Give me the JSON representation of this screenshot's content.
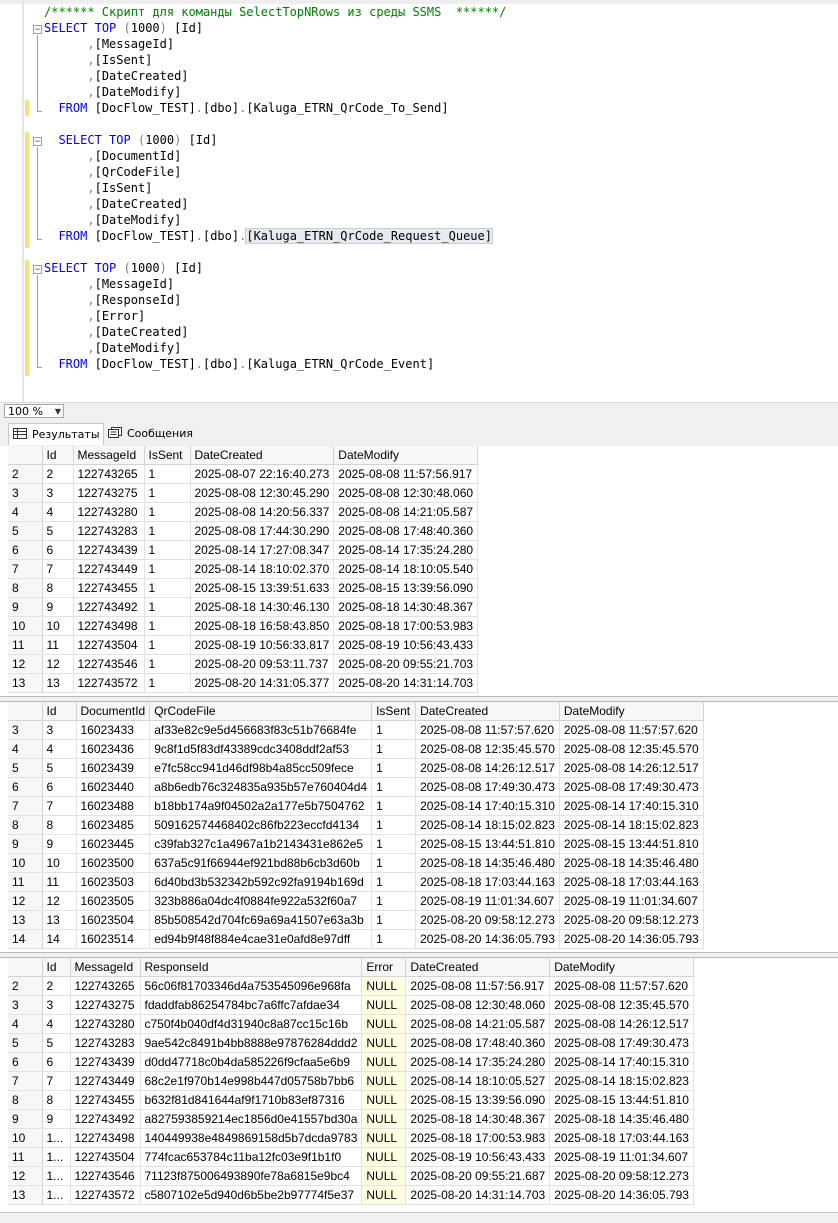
{
  "editor": {
    "comment": "/****** Скрипт для команды SelectTopNRows из среды SSMS  ******/",
    "q1": {
      "select": "SELECT",
      "top": "TOP",
      "n": "(1000)",
      "first": "[Id]",
      "cols": [
        "[MessageId]",
        "[IsSent]",
        "[DateCreated]",
        "[DateModify]"
      ],
      "from": "FROM",
      "db": "[DocFlow_TEST]",
      "schema": "[dbo]",
      "table": "[Kaluga_ETRN_QrCode_To_Send]"
    },
    "q2": {
      "select": "SELECT",
      "top": "TOP",
      "n": "(1000)",
      "first": "[Id]",
      "cols": [
        "[DocumentId]",
        "[QrCodeFile]",
        "[IsSent]",
        "[DateCreated]",
        "[DateModify]"
      ],
      "from": "FROM",
      "db": "[DocFlow_TEST]",
      "schema": "[dbo]",
      "table": "[Kaluga_ETRN_QrCode_Request_Queue]"
    },
    "q3": {
      "select": "SELECT",
      "top": "TOP",
      "n": "(1000)",
      "first": "[Id]",
      "cols": [
        "[MessageId]",
        "[ResponseId]",
        "[Error]",
        "[DateCreated]",
        "[DateModify]"
      ],
      "from": "FROM",
      "db": "[DocFlow_TEST]",
      "schema": "[dbo]",
      "table": "[Kaluga_ETRN_QrCode_Event]"
    }
  },
  "zoom": {
    "value": "100 %"
  },
  "tabs": {
    "results": "Результаты",
    "messages": "Сообщения"
  },
  "grid1": {
    "headers": [
      "",
      "Id",
      "MessageId",
      "IsSent",
      "DateCreated",
      "DateModify"
    ],
    "rows": [
      [
        "2",
        "2",
        "122743265",
        "1",
        "2025-08-07 22:16:40.273",
        "2025-08-08 11:57:56.917"
      ],
      [
        "3",
        "3",
        "122743275",
        "1",
        "2025-08-08 12:30:45.290",
        "2025-08-08 12:30:48.060"
      ],
      [
        "4",
        "4",
        "122743280",
        "1",
        "2025-08-08 14:20:56.337",
        "2025-08-08 14:21:05.587"
      ],
      [
        "5",
        "5",
        "122743283",
        "1",
        "2025-08-08 17:44:30.290",
        "2025-08-08 17:48:40.360"
      ],
      [
        "6",
        "6",
        "122743439",
        "1",
        "2025-08-14 17:27:08.347",
        "2025-08-14 17:35:24.280"
      ],
      [
        "7",
        "7",
        "122743449",
        "1",
        "2025-08-14 18:10:02.370",
        "2025-08-14 18:10:05.540"
      ],
      [
        "8",
        "8",
        "122743455",
        "1",
        "2025-08-15 13:39:51.633",
        "2025-08-15 13:39:56.090"
      ],
      [
        "9",
        "9",
        "122743492",
        "1",
        "2025-08-18 14:30:46.130",
        "2025-08-18 14:30:48.367"
      ],
      [
        "10",
        "10",
        "122743498",
        "1",
        "2025-08-18 16:58:43.850",
        "2025-08-18 17:00:53.983"
      ],
      [
        "11",
        "11",
        "122743504",
        "1",
        "2025-08-19 10:56:33.817",
        "2025-08-19 10:56:43.433"
      ],
      [
        "12",
        "12",
        "122743546",
        "1",
        "2025-08-20 09:53:11.737",
        "2025-08-20 09:55:21.703"
      ],
      [
        "13",
        "13",
        "122743572",
        "1",
        "2025-08-20 14:31:05.377",
        "2025-08-20 14:31:14.703"
      ]
    ]
  },
  "grid2": {
    "headers": [
      "",
      "Id",
      "DocumentId",
      "QrCodeFile",
      "IsSent",
      "DateCreated",
      "DateModify"
    ],
    "rows": [
      [
        "3",
        "3",
        "16023433",
        "af33e82c9e5d456683f83c51b76684fe",
        "1",
        "2025-08-08 11:57:57.620",
        "2025-08-08 11:57:57.620"
      ],
      [
        "4",
        "4",
        "16023436",
        "9c8f1d5f83df43389cdc3408ddf2af53",
        "1",
        "2025-08-08 12:35:45.570",
        "2025-08-08 12:35:45.570"
      ],
      [
        "5",
        "5",
        "16023439",
        "e7fc58cc941d46df98b4a85cc509fece",
        "1",
        "2025-08-08 14:26:12.517",
        "2025-08-08 14:26:12.517"
      ],
      [
        "6",
        "6",
        "16023440",
        "a8b6edb76c324835a935b57e760404d4",
        "1",
        "2025-08-08 17:49:30.473",
        "2025-08-08 17:49:30.473"
      ],
      [
        "7",
        "7",
        "16023488",
        "b18bb174a9f04502a2a177e5b7504762",
        "1",
        "2025-08-14 17:40:15.310",
        "2025-08-14 17:40:15.310"
      ],
      [
        "8",
        "8",
        "16023485",
        "509162574468402c86fb223eccfd4134",
        "1",
        "2025-08-14 18:15:02.823",
        "2025-08-14 18:15:02.823"
      ],
      [
        "9",
        "9",
        "16023445",
        "c39fab327c1a4967a1b2143431e862e5",
        "1",
        "2025-08-15 13:44:51.810",
        "2025-08-15 13:44:51.810"
      ],
      [
        "10",
        "10",
        "16023500",
        "637a5c91f66944ef921bd88b6cb3d60b",
        "1",
        "2025-08-18 14:35:46.480",
        "2025-08-18 14:35:46.480"
      ],
      [
        "11",
        "11",
        "16023503",
        "6d40bd3b532342b592c92fa9194b169d",
        "1",
        "2025-08-18 17:03:44.163",
        "2025-08-18 17:03:44.163"
      ],
      [
        "12",
        "12",
        "16023505",
        "323b886a04dc4f0884fe922a532f60a7",
        "1",
        "2025-08-19 11:01:34.607",
        "2025-08-19 11:01:34.607"
      ],
      [
        "13",
        "13",
        "16023504",
        "85b508542d704fc69a69a41507e63a3b",
        "1",
        "2025-08-20 09:58:12.273",
        "2025-08-20 09:58:12.273"
      ],
      [
        "14",
        "14",
        "16023514",
        "ed94b9f48f884e4cae31e0afd8e97dff",
        "1",
        "2025-08-20 14:36:05.793",
        "2025-08-20 14:36:05.793"
      ]
    ]
  },
  "grid3": {
    "headers": [
      "",
      "Id",
      "MessageId",
      "ResponseId",
      "Error",
      "DateCreated",
      "DateModify"
    ],
    "rows": [
      [
        "2",
        "2",
        "122743265",
        "56c06f81703346d4a753545096e968fa",
        "NULL",
        "2025-08-08 11:57:56.917",
        "2025-08-08 11:57:57.620"
      ],
      [
        "3",
        "3",
        "122743275",
        "fdaddfab86254784bc7a6ffc7afdae34",
        "NULL",
        "2025-08-08 12:30:48.060",
        "2025-08-08 12:35:45.570"
      ],
      [
        "4",
        "4",
        "122743280",
        "c750f4b040df4d31940c8a87cc15c16b",
        "NULL",
        "2025-08-08 14:21:05.587",
        "2025-08-08 14:26:12.517"
      ],
      [
        "5",
        "5",
        "122743283",
        "9ae542c8491b4bb8888e97876284ddd2",
        "NULL",
        "2025-08-08 17:48:40.360",
        "2025-08-08 17:49:30.473"
      ],
      [
        "6",
        "6",
        "122743439",
        "d0dd47718c0b4da585226f9cfaa5e6b9",
        "NULL",
        "2025-08-14 17:35:24.280",
        "2025-08-14 17:40:15.310"
      ],
      [
        "7",
        "7",
        "122743449",
        "68c2e1f970b14e998b447d05758b7bb6",
        "NULL",
        "2025-08-14 18:10:05.527",
        "2025-08-14 18:15:02.823"
      ],
      [
        "8",
        "8",
        "122743455",
        "b632f81d841644af9f1710b83ef87316",
        "NULL",
        "2025-08-15 13:39:56.090",
        "2025-08-15 13:44:51.810"
      ],
      [
        "9",
        "9",
        "122743492",
        "a827593859214ec1856d0e41557bd30a",
        "NULL",
        "2025-08-18 14:30:48.367",
        "2025-08-18 14:35:46.480"
      ],
      [
        "10",
        "1...",
        "122743498",
        "140449938e4849869158d5b7dcda9783",
        "NULL",
        "2025-08-18 17:00:53.983",
        "2025-08-18 17:03:44.163"
      ],
      [
        "11",
        "1...",
        "122743504",
        "774fcac653784c11ba12fc03e9f1b1f0",
        "NULL",
        "2025-08-19 10:56:43.433",
        "2025-08-19 11:01:34.607"
      ],
      [
        "12",
        "1...",
        "122743546",
        "71123f875006493890fe78a6815e9bc4",
        "NULL",
        "2025-08-20 09:55:21.687",
        "2025-08-20 09:58:12.273"
      ],
      [
        "13",
        "1...",
        "122743572",
        "c5807102e5d940d6b5be2b97774f5e37",
        "NULL",
        "2025-08-20 14:31:14.703",
        "2025-08-20 14:36:05.793"
      ]
    ]
  }
}
